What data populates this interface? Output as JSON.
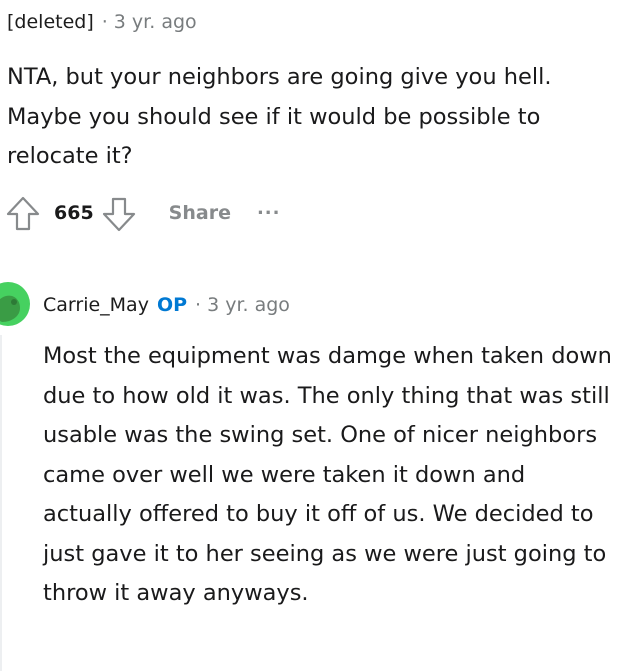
{
  "comment1": {
    "author": "[deleted]",
    "separator": "·",
    "time": "3 yr. ago",
    "body": "NTA, but your neighbors are going give you hell. Maybe you should see if it would be possible to relocate it?",
    "actions": {
      "upvote_icon": "upvote-arrow-icon",
      "score": "665",
      "downvote_icon": "downvote-arrow-icon",
      "share_label": "Share",
      "more_label": "..."
    }
  },
  "comment2": {
    "avatar_icon": "snoo-avatar-icon",
    "author": "Carrie_May",
    "badge": "OP",
    "separator": "·",
    "time": "3 yr. ago",
    "body": "Most the equipment was damge when taken down due to how old it was. The only thing that was still usable was the swing set. One of nicer neighbors came over well we were taken it down and actually offered to buy it off of us. We decided to just gave it to her seeing as we were just going to throw it away anyways."
  },
  "colors": {
    "text": "#1a1a1b",
    "meta": "#787c7e",
    "op_badge": "#0079d3",
    "action_gray": "#878a8c",
    "avatar_green": "#46d160",
    "thread_line": "#edeff1"
  }
}
